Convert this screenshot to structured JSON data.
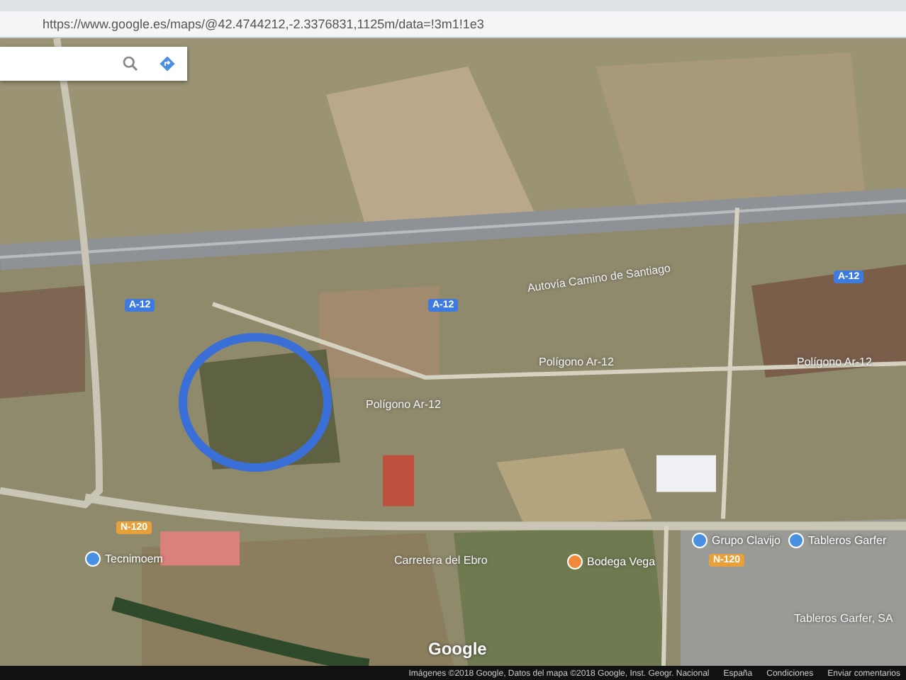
{
  "browser": {
    "url": "https://www.google.es/maps/@42.4744212,-2.3376831,1125m/data=!3m1!1e3"
  },
  "map": {
    "labels": [
      {
        "kind": "shield",
        "text": "A-12",
        "color": "#3d7be0"
      },
      {
        "kind": "road",
        "text": "Autovía Camino de Santiago"
      },
      {
        "kind": "shield",
        "text": "A-12",
        "color": "#3d7be0"
      },
      {
        "kind": "shield",
        "text": "A-12",
        "color": "#3d7be0"
      },
      {
        "kind": "road",
        "text": "Polígono Ar-12"
      },
      {
        "kind": "road",
        "text": "Polígono Ar-12"
      },
      {
        "kind": "road",
        "text": "Polígono Ar-12"
      },
      {
        "kind": "shield",
        "text": "N-120",
        "color": "#e8a03a"
      },
      {
        "kind": "place",
        "text": "Grupo Clavijo",
        "color": "#4a90e2"
      },
      {
        "kind": "place",
        "text": "Tableros Garfer",
        "color": "#4a90e2"
      },
      {
        "kind": "place",
        "text": "Tecnimoem",
        "color": "#4a90e2"
      },
      {
        "kind": "road",
        "text": "Carretera del Ebro"
      },
      {
        "kind": "place",
        "text": "Bodega Vega",
        "color": "#f08a3a"
      },
      {
        "kind": "shield",
        "text": "N-120",
        "color": "#e8a03a"
      },
      {
        "kind": "road",
        "text": "Tableros Garfer, SA"
      }
    ],
    "logo": "Google",
    "attribution": [
      "Imágenes ©2018 Google, Datos del mapa ©2018 Google, Inst. Geogr. Nacional",
      "España",
      "Condiciones",
      "Enviar comentarios"
    ]
  }
}
